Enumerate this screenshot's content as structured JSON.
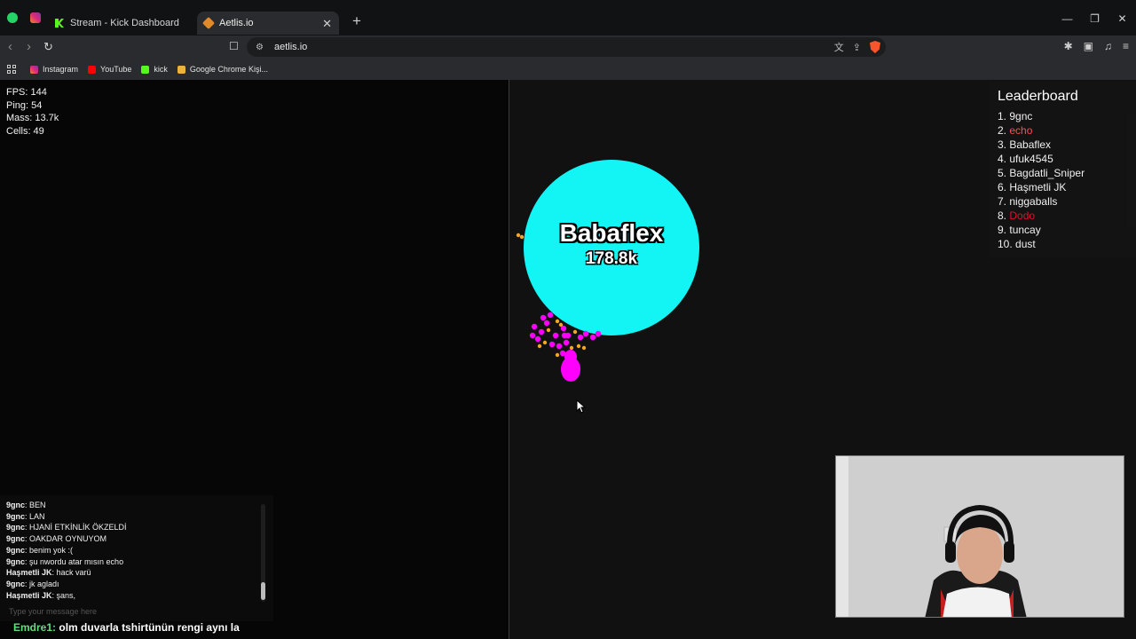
{
  "browser": {
    "tabs": [
      {
        "title": "Stream - Kick Dashboard",
        "favicon": "kick-icon",
        "active": false
      },
      {
        "title": "Aetlis.io",
        "favicon": "aetlis-icon",
        "active": true
      }
    ],
    "url": "aetlis.io",
    "bookmarks": [
      "Instagram",
      "YouTube",
      "kick",
      "Google Chrome Kişi..."
    ]
  },
  "game": {
    "stats": {
      "fps": "FPS: 144",
      "ping": "Ping: 54",
      "mass": "Mass: 13.7k",
      "cells": "Cells: 49"
    },
    "leaderboard": {
      "title": "Leaderboard",
      "entries": [
        {
          "rank": "1.",
          "name": "9gnc",
          "color": "#f0f0f0"
        },
        {
          "rank": "2.",
          "name": "echo",
          "color": "#ff4d4d"
        },
        {
          "rank": "3.",
          "name": "Babaflex",
          "color": "#f0f0f0"
        },
        {
          "rank": "4.",
          "name": "ufuk4545",
          "color": "#f0f0f0"
        },
        {
          "rank": "5.",
          "name": "Bagdatli_Sniper",
          "color": "#f0f0f0"
        },
        {
          "rank": "6.",
          "name": "Haşmetli JK",
          "color": "#f0f0f0"
        },
        {
          "rank": "7.",
          "name": "niggaballs",
          "color": "#f0f0f0"
        },
        {
          "rank": "8.",
          "name": "Dodo",
          "color": "#e0102a"
        },
        {
          "rank": "9.",
          "name": "tuncay",
          "color": "#f0f0f0"
        },
        {
          "rank": "10.",
          "name": "dust",
          "color": "#f0f0f0"
        }
      ]
    },
    "player": {
      "name": "Babaflex",
      "mass": "178.8k",
      "color": "#13f4f4"
    },
    "chat": {
      "messages": [
        {
          "user": "9gnc",
          "text": ": BEN"
        },
        {
          "user": "9gnc",
          "text": ": LAN"
        },
        {
          "user": "9gnc",
          "text": ": HJANİ ETKİNLİK ÖKZELDİ"
        },
        {
          "user": "9gnc",
          "text": ": OAKDAR OYNUYOM"
        },
        {
          "user": "9gnc",
          "text": ": benim yok :("
        },
        {
          "user": "9gnc",
          "text": ": şu nwordu atar mısın echo"
        },
        {
          "user": "Haşmetli JK",
          "text": ": hack varü"
        },
        {
          "user": "9gnc",
          "text": ": jk agladı"
        },
        {
          "user": "Haşmetli JK",
          "text": ": şans,"
        }
      ],
      "placeholder": "Type your message here"
    }
  },
  "stream_overlay": {
    "user": "Emdre1:",
    "message": "olm duvarla tshirtünün rengi aynı la"
  }
}
